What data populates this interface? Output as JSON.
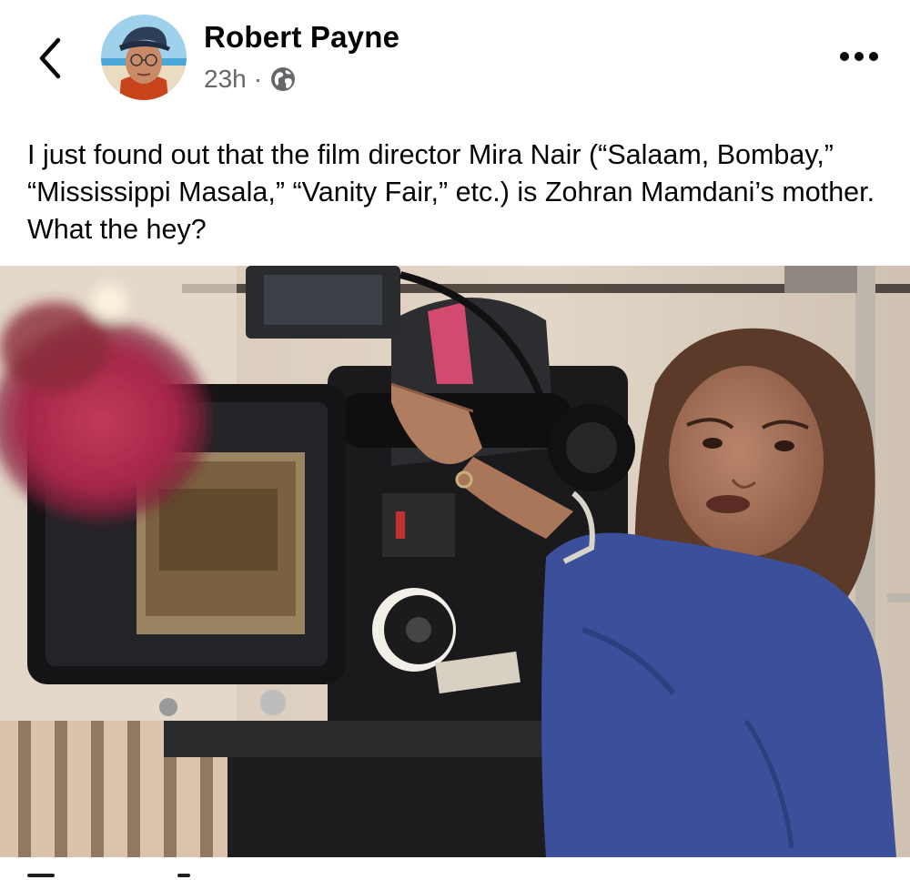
{
  "post": {
    "author": "Robert Payne",
    "time": "23h",
    "separator": "·",
    "audience_icon": "globe-icon",
    "back_icon": "chevron-left-icon",
    "more_icon": "more-dots-icon",
    "text": "I just found out that the film director Mira Nair (“Salaam, Bombay,” “Mississippi Masala,” “Vanity Fair,” etc.) is Zohran Mamdani’s mother.  What the hey?"
  },
  "colors": {
    "primary_text": "#050505",
    "secondary_text": "#65676b",
    "background": "#ffffff"
  }
}
